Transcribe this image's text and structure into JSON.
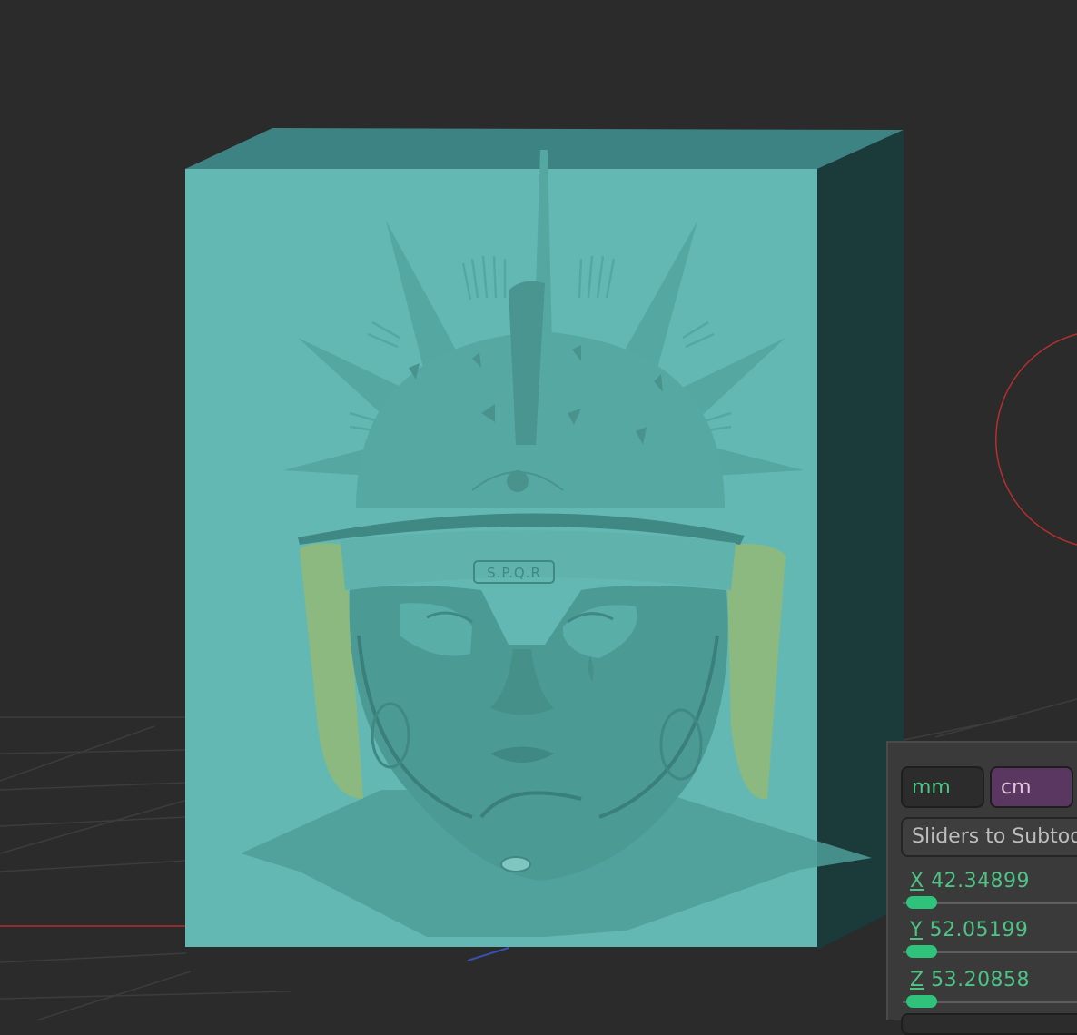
{
  "viewport": {
    "background": "#2b2b2b",
    "block_front_color": "#63b8b4",
    "block_top_color": "#3d8384",
    "block_side_color": "#1b3a3a",
    "helmet_color": "#4e9e98",
    "ear_guard_color": "#8fb97a",
    "axis_x_color": "#b3302e",
    "helmet_badge": "S.P.Q.R"
  },
  "panel": {
    "unit_mm": "mm",
    "unit_cm": "cm",
    "sliders_button": "Sliders to Subtool",
    "x_axis": "X",
    "x_value": "42.34899",
    "y_axis": "Y",
    "y_value": "52.05199",
    "z_axis": "Z",
    "z_value": "53.20858",
    "accent_color": "#4fc286",
    "active_unit_color": "#5a3760"
  }
}
